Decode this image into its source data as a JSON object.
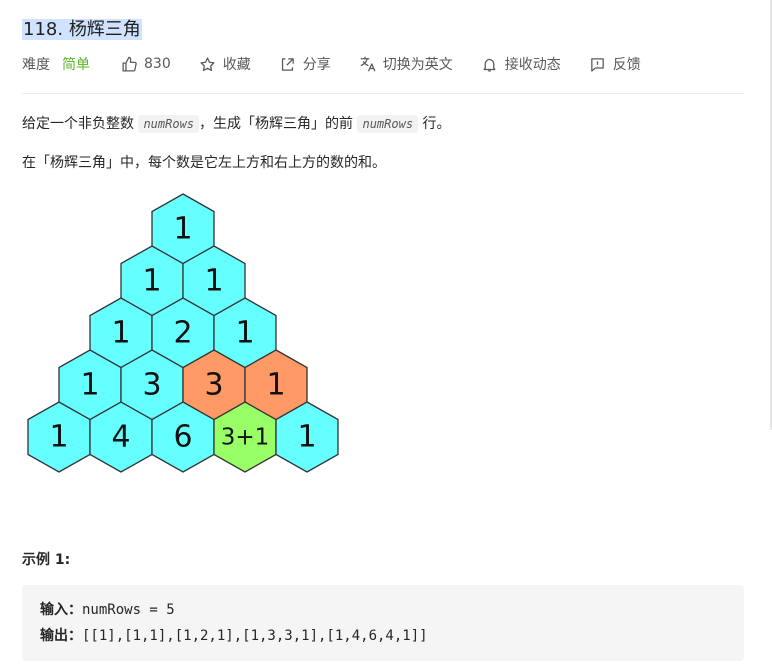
{
  "problem": {
    "number": "118.",
    "title": "杨辉三角"
  },
  "meta": {
    "difficulty_label": "难度",
    "difficulty_value": "简单",
    "likes": "830",
    "favorite_label": "收藏",
    "share_label": "分享",
    "translate_label": "切换为英文",
    "subscribe_label": "接收动态",
    "feedback_label": "反馈",
    "difficulty_color": "#5ab726"
  },
  "description": {
    "p1_before": "给定一个非负整数 ",
    "p1_code1": "numRows",
    "p1_middle": "，生成「杨辉三角」的前 ",
    "p1_code2": "numRows",
    "p1_after": " 行。",
    "p2": "在「杨辉三角」中，每个数是它左上方和右上方的数的和。"
  },
  "triangle": {
    "rows": [
      [
        "1"
      ],
      [
        "1",
        "1"
      ],
      [
        "1",
        "2",
        "1"
      ],
      [
        "1",
        "3",
        "3",
        "1"
      ],
      [
        "1",
        "4",
        "6",
        "3+1",
        "1"
      ]
    ],
    "colors": {
      "default": "#66ffff",
      "highlight_parent": "#ff9966",
      "highlight_sum": "#99ff66",
      "stroke": "#333333"
    },
    "highlighted_parents": [
      [
        3,
        2
      ],
      [
        3,
        3
      ]
    ],
    "highlighted_sum": [
      4,
      3
    ]
  },
  "example": {
    "title": "示例 1:",
    "input_label": "输入：",
    "input_value": "numRows = 5",
    "output_label": "输出：",
    "output_value": "[[1],[1,1],[1,2,1],[1,3,3,1],[1,4,6,4,1]]"
  }
}
